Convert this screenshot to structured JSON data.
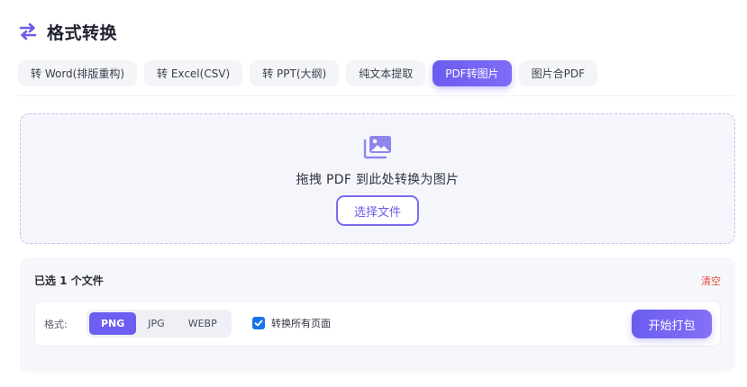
{
  "header": {
    "icon": "swap-arrows-icon",
    "title": "格式转换"
  },
  "tabs": [
    {
      "label": "转 Word(排版重构)",
      "active": false
    },
    {
      "label": "转 Excel(CSV)",
      "active": false
    },
    {
      "label": "转 PPT(大纲)",
      "active": false
    },
    {
      "label": "纯文本提取",
      "active": false
    },
    {
      "label": "PDF转图片",
      "active": true
    },
    {
      "label": "图片合PDF",
      "active": false
    }
  ],
  "dropzone": {
    "icon": "images-icon",
    "text": "拖拽 PDF 到此处转换为图片",
    "button_label": "选择文件"
  },
  "files": {
    "count_text": "已选 1 个文件",
    "clear_label": "清空"
  },
  "options": {
    "format_label": "格式:",
    "formats": [
      "PNG",
      "JPG",
      "WEBP"
    ],
    "selected_format": "PNG",
    "all_pages_label": "转换所有页面",
    "all_pages_checked": true,
    "start_label": "开始打包"
  },
  "colors": {
    "accent": "#6d5df0",
    "danger": "#e8473f",
    "checkbox": "#1a73e8"
  }
}
